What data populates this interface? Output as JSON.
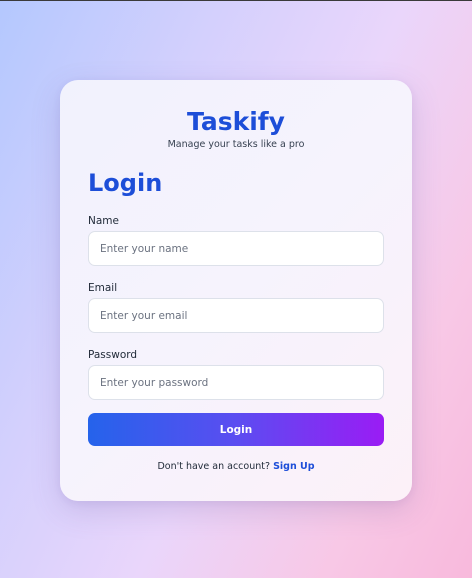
{
  "brand": {
    "title": "Taskify",
    "subtitle": "Manage your tasks like a pro"
  },
  "form": {
    "heading": "Login",
    "fields": [
      {
        "label": "Name",
        "value": "",
        "placeholder": "Enter your name"
      },
      {
        "label": "Email",
        "value": "",
        "placeholder": "Enter your email"
      },
      {
        "label": "Password",
        "value": "",
        "placeholder": "Enter your password"
      }
    ],
    "submit_label": "Login"
  },
  "footer": {
    "prompt": "Don't have an account?",
    "link_label": "Sign Up"
  },
  "colors": {
    "brand_blue": "#1d4ed8",
    "button_gradient_start": "#2563eb",
    "button_gradient_end": "#9a1cf4"
  }
}
